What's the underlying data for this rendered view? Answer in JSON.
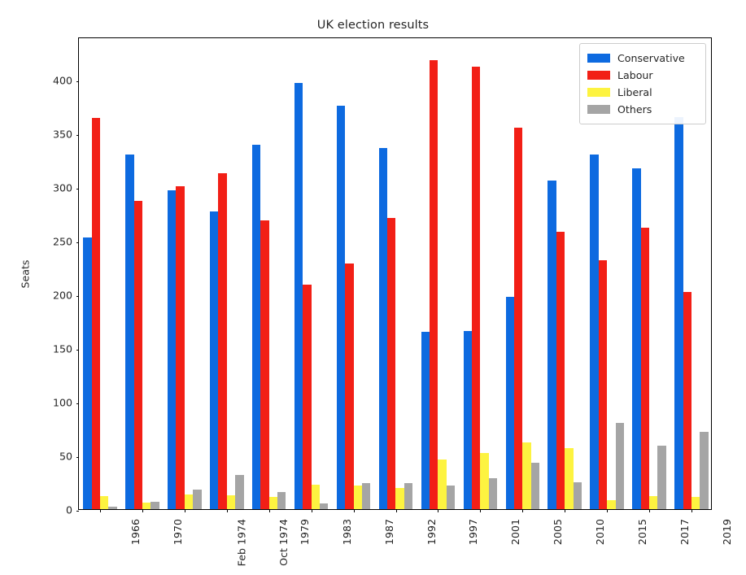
{
  "chart_data": {
    "type": "bar",
    "title": "UK election results",
    "xlabel": "",
    "ylabel": "Seats",
    "ylim": [
      0,
      440
    ],
    "yticks": [
      0,
      50,
      100,
      150,
      200,
      250,
      300,
      350,
      400
    ],
    "grid": false,
    "legend_position": "upper right",
    "categories": [
      "1966",
      "1970",
      "Feb 1974",
      "Oct 1974",
      "1979",
      "1983",
      "1987",
      "1992",
      "1997",
      "2001",
      "2005",
      "2010",
      "2015",
      "2017",
      "2019"
    ],
    "series": [
      {
        "name": "Conservative",
        "color": "#0d6ae0",
        "values": [
          253,
          330,
          297,
          277,
          339,
          397,
          376,
          336,
          165,
          166,
          198,
          306,
          330,
          317,
          365
        ]
      },
      {
        "name": "Labour",
        "color": "#f21f16",
        "values": [
          364,
          287,
          301,
          313,
          269,
          209,
          229,
          271,
          418,
          412,
          355,
          258,
          232,
          262,
          202
        ]
      },
      {
        "name": "Liberal",
        "color": "#fdf340",
        "values": [
          12,
          6,
          14,
          13,
          11,
          23,
          22,
          20,
          46,
          52,
          62,
          57,
          8,
          12,
          11
        ]
      },
      {
        "name": "Others",
        "color": "#a5a5a5",
        "values": [
          2,
          7,
          18,
          32,
          16,
          5,
          24,
          24,
          22,
          29,
          43,
          25,
          80,
          59,
          72
        ]
      }
    ]
  },
  "legend": {
    "entries": [
      {
        "label": "Conservative",
        "color": "#0d6ae0"
      },
      {
        "label": "Labour",
        "color": "#f21f16"
      },
      {
        "label": "Liberal",
        "color": "#fdf340"
      },
      {
        "label": "Others",
        "color": "#a5a5a5"
      }
    ]
  }
}
